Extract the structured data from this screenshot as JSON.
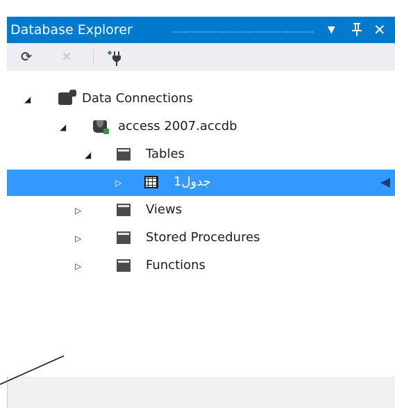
{
  "panel": {
    "title": "Database Explorer",
    "accent": "#007acc",
    "selection_color": "#3399ff",
    "controls": {
      "dropdown": "▼",
      "pin": "ꟸ",
      "close": "✕"
    }
  },
  "toolbar": {
    "refresh": "⟳",
    "delete": "✕",
    "connect": "⁺ᵠ"
  },
  "tree": {
    "root": {
      "label": "Data Connections",
      "icon": "data-connections-icon",
      "expanded": true
    },
    "database": {
      "label": "access 2007.accdb",
      "icon": "database-icon",
      "expanded": true
    },
    "tables": {
      "label": "Tables",
      "icon": "folder-icon",
      "expanded": true
    },
    "table1": {
      "label": "جدول1",
      "icon": "table-icon",
      "expanded": false,
      "selected": true
    },
    "views": {
      "label": "Views",
      "icon": "folder-icon",
      "expanded": false
    },
    "stored_procedures": {
      "label": "Stored Procedures",
      "icon": "folder-icon",
      "expanded": false
    },
    "functions": {
      "label": "Functions",
      "icon": "folder-icon",
      "expanded": false
    }
  },
  "glyphs": {
    "expanded": "◢",
    "collapsed": "▷"
  }
}
